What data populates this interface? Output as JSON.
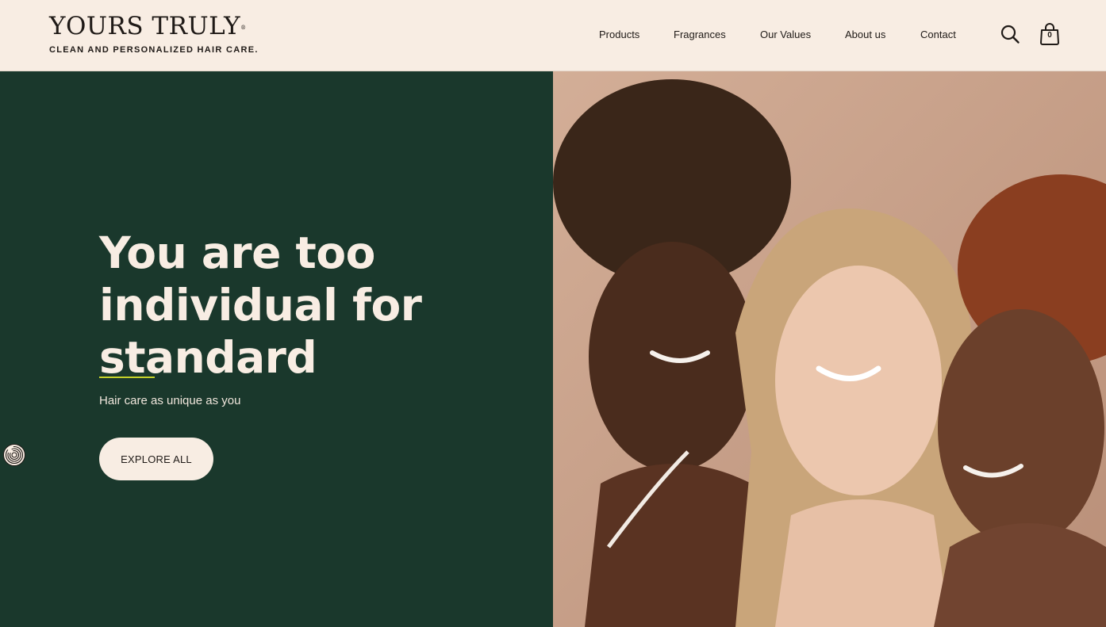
{
  "header": {
    "logo": {
      "name": "YOURS TRULY",
      "reg_mark": "®",
      "tagline": "CLEAN AND PERSONALIZED HAIR CARE."
    },
    "nav": [
      {
        "label": "Products"
      },
      {
        "label": "Fragrances"
      },
      {
        "label": "Our Values"
      },
      {
        "label": "About us"
      },
      {
        "label": "Contact"
      }
    ],
    "cart_count": "0",
    "icons": {
      "search": "search-icon",
      "cart": "shopping-bag-icon"
    }
  },
  "hero": {
    "headline_lines": [
      "You are too",
      "individual for",
      "standard"
    ],
    "subheadline": "Hair care as unique as you",
    "cta_label": "EXPLORE ALL",
    "image": "three smiling women with curly, blonde and red hair"
  },
  "colors": {
    "background": "#f8ede3",
    "hero_green": "#1a382c",
    "accent_underline": "#c4d12a",
    "text_dark": "#1f1a17"
  }
}
